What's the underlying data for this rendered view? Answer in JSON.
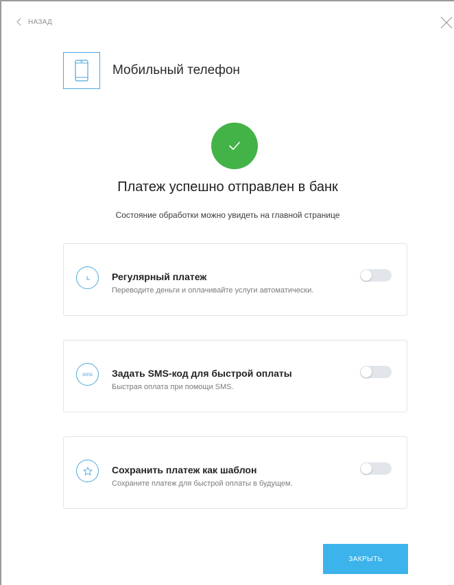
{
  "nav": {
    "back_label": "НАЗАД"
  },
  "service": {
    "title": "Мобильный телефон"
  },
  "status": {
    "headline": "Платеж успешно отправлен в банк",
    "subline": "Состояние обработки можно увидеть на главной странице"
  },
  "options": [
    {
      "icon": "clock-icon",
      "title": "Регулярный платеж",
      "description": "Переводите деньги и оплачивайте услуги автоматически.",
      "enabled": false
    },
    {
      "icon": "sms-icon",
      "icon_text": "sms",
      "title": "Задать SMS-код для быстрой оплаты",
      "description": "Быстрая оплата при помощи SMS.",
      "enabled": false
    },
    {
      "icon": "star-icon",
      "title": "Сохранить платеж как шаблон",
      "description": "Сохраните платеж для быстрой оплаты в будущем.",
      "enabled": false
    }
  ],
  "actions": {
    "close_label": "ЗАКРЫТЬ"
  },
  "colors": {
    "accent": "#4aa8dc",
    "success": "#43b348",
    "button": "#3cb3ea",
    "toggle_off": "#e2e6ea"
  }
}
